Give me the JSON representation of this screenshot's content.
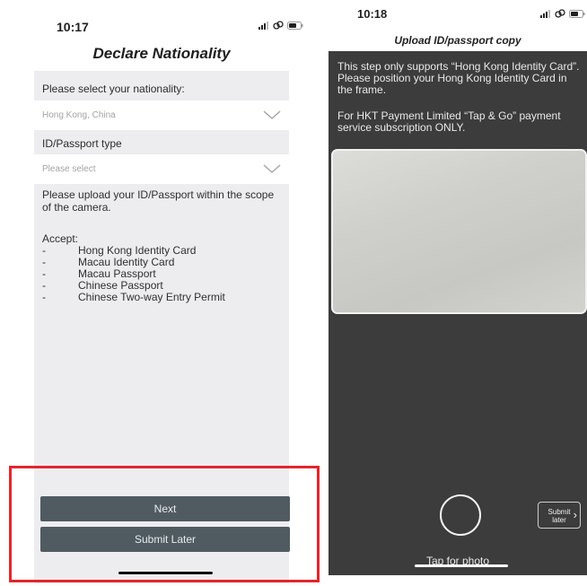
{
  "left_screen": {
    "status_time": "10:17",
    "title": "Declare Nationality",
    "nationality_label": "Please select your nationality:",
    "nationality_value": "Hong Kong, China",
    "id_type_label": "ID/Passport type",
    "id_type_placeholder": "Please select",
    "instructions": "Please upload your ID/Passport within the scope of the camera.",
    "accept_label": "Accept:",
    "accept_items": [
      "Hong Kong Identity Card",
      "Macau Identity Card",
      "Macau Passport",
      "Chinese Passport",
      "Chinese Two-way Entry Permit"
    ],
    "next_button": "Next",
    "submit_later_button": "Submit Later"
  },
  "right_screen": {
    "status_time": "10:18",
    "title": "Upload ID/passport copy",
    "guide_text_1": "This step only supports “Hong Kong Identity Card”. Please position your Hong Kong Identity Card in the frame.",
    "guide_text_2": "For HKT Payment Limited “Tap & Go” payment service subscription ONLY.",
    "submit_later_line1": "Submit",
    "submit_later_line2": "later",
    "tap_for_photo": "Tap for photo"
  },
  "icons": {
    "signal": "signal-icon",
    "wifi": "wifi-icon",
    "battery": "battery-icon",
    "chevron": "chevron-down-icon",
    "shutter": "camera-shutter-icon",
    "chevron_right": "chevron-right-icon"
  },
  "colors": {
    "button_bg": "#505b61",
    "form_bg": "#ededf0",
    "camera_bg": "#3c3c3c",
    "highlight": "#e3262c"
  }
}
